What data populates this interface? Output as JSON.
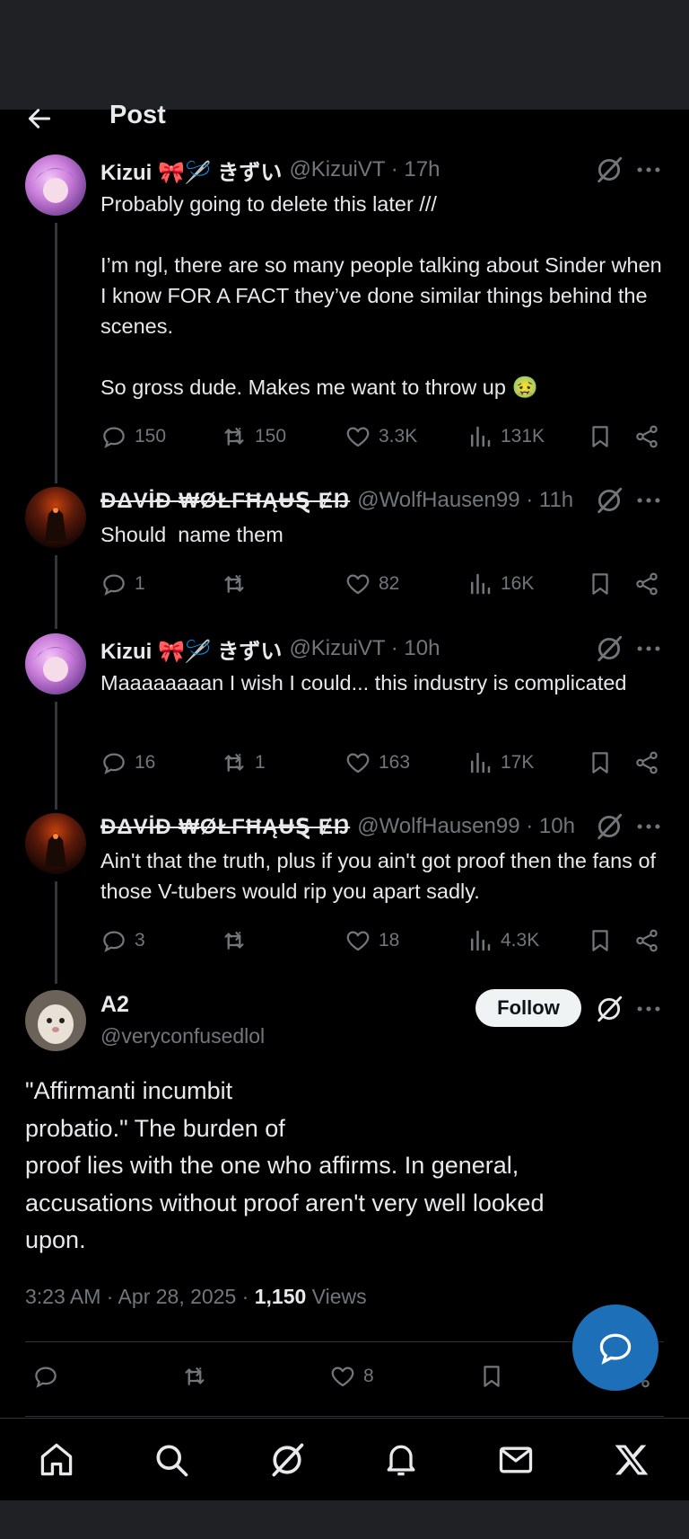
{
  "header": {
    "title": "Post"
  },
  "tweets": [
    {
      "name": "Kizui 🎀🪡 きずい",
      "handle": "@KizuiVT · 17h",
      "text": "Probably going to delete this later ///\n\nI’m ngl, there are so many people talking about Sinder when I know FOR A FACT they’ve done similar things behind the scenes.\n\nSo gross dude. Makes me want to throw up 🤢",
      "replies": "150",
      "reposts": "150",
      "likes": "3.3K",
      "views": "131K"
    },
    {
      "name": "ĐΔVİÐ ₩ØŁFĦĄɄⱾ ɆŊ",
      "handle": "@WolfHausen99 · 11h",
      "text": "Should  name them",
      "replies": "1",
      "reposts": "",
      "likes": "82",
      "views": "16K"
    },
    {
      "name": "Kizui 🎀🪡 きずい",
      "handle": "@KizuiVT · 10h",
      "text": "Maaaaaaaan I wish I could... this industry is complicated",
      "replies": "16",
      "reposts": "1",
      "likes": "163",
      "views": "17K"
    },
    {
      "name": "ĐΔVİÐ ₩ØŁFĦĄɄⱾ ɆŊ",
      "handle": "@WolfHausen99 · 10h",
      "text": "Ain't that the truth, plus if you ain't got proof then the fans of those V-tubers would rip you apart sadly.",
      "replies": "3",
      "reposts": "",
      "likes": "18",
      "views": "4.3K"
    }
  ],
  "main": {
    "name": "A2",
    "handle": "@veryconfusedlol",
    "follow_label": "Follow",
    "text": "\"Affirmanti incumbit\nprobatio.\" The burden of\nproof lies with the one who affirms. In general,\naccusations without proof aren't very well looked\nupon.",
    "time": "3:23 AM · Apr 28, 2025 · ",
    "views_count": "1,150",
    "views_label": " Views",
    "likes": "8"
  },
  "icons": {
    "back": "arrow-left-icon",
    "grok": "grok-icon",
    "more": "more-icon",
    "reply": "reply-icon",
    "repost": "repost-icon",
    "like": "heart-icon",
    "views": "views-icon",
    "bookmark": "bookmark-icon",
    "share": "share-icon",
    "nav": [
      "home-icon",
      "search-icon",
      "grok-icon",
      "bell-icon",
      "mail-icon",
      "x-logo-icon"
    ]
  },
  "colors": {
    "background": "#000000",
    "text": "#e7e9ea",
    "muted": "#71767b",
    "fab": "#1d6fb8",
    "follow_bg": "#eff3f4"
  }
}
